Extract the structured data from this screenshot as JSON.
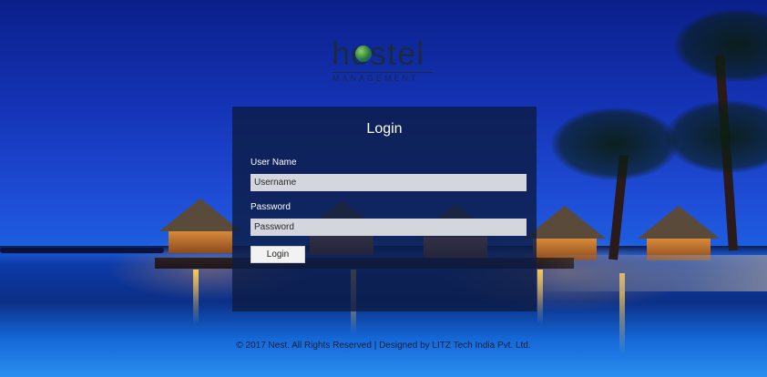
{
  "logo": {
    "word": "hostel",
    "sub": "MANAGEMENT"
  },
  "login": {
    "title": "Login",
    "username_label": "User Name",
    "username_placeholder": "Username",
    "password_label": "Password",
    "password_placeholder": "Password",
    "button_label": "Login"
  },
  "footer": {
    "text": "© 2017 Nest. All Rights Reserved | Designed by LITZ Tech India Pvt. Ltd."
  },
  "colors": {
    "sky": "#1535b8",
    "panel": "#0c1c46",
    "input_bg": "#d3d6dc"
  }
}
